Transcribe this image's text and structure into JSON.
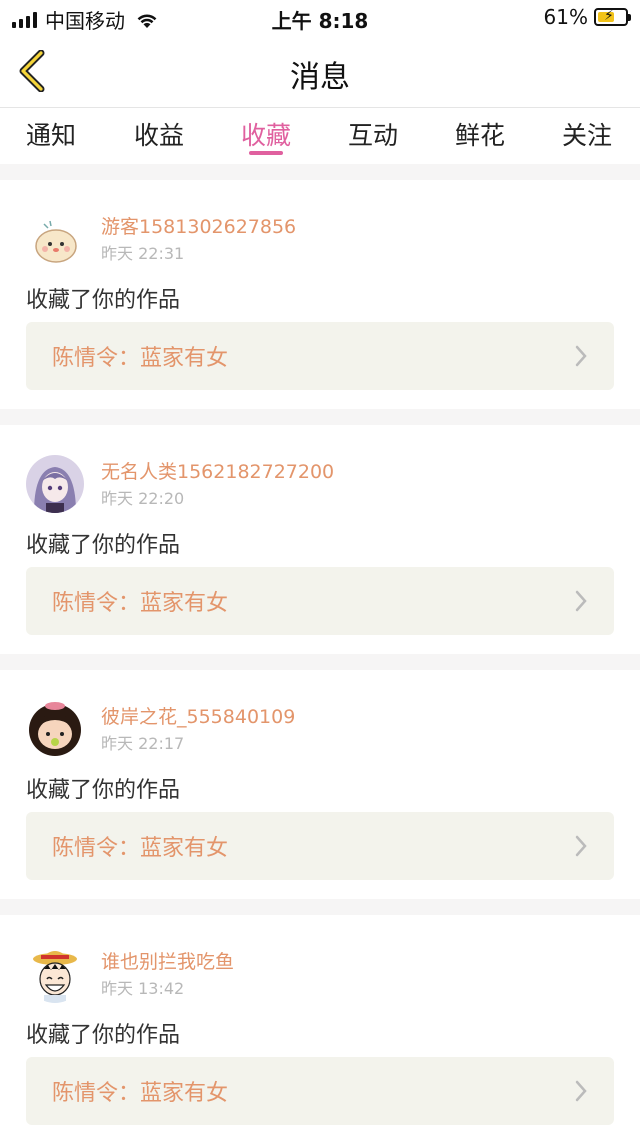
{
  "status_bar": {
    "carrier": "中国移动",
    "time": "上午 8:18",
    "battery_percent": "61%",
    "battery_level": 0.61,
    "battery_color": "#f2c31a"
  },
  "header": {
    "title": "消息",
    "back_icon": "chevron-left-icon"
  },
  "tabs": [
    {
      "label": "通知",
      "active": false
    },
    {
      "label": "收益",
      "active": false
    },
    {
      "label": "收藏",
      "active": true
    },
    {
      "label": "互动",
      "active": false
    },
    {
      "label": "鲜花",
      "active": false
    },
    {
      "label": "关注",
      "active": false
    }
  ],
  "colors": {
    "accent": "#e0609f",
    "name_orange": "#e3956b",
    "card_bg": "#f3f3ec"
  },
  "items": [
    {
      "username": "游客1581302627856",
      "time": "昨天 22:31",
      "action": "收藏了你的作品",
      "work": "陈情令：蓝家有女",
      "avatar": "chick-cartoon-avatar"
    },
    {
      "username": "无名人类1562182727200",
      "time": "昨天 22:20",
      "action": "收藏了你的作品",
      "work": "陈情令：蓝家有女",
      "avatar": "anime-girl-avatar"
    },
    {
      "username": "彼岸之花_555840109",
      "time": "昨天 22:17",
      "action": "收藏了你的作品",
      "work": "陈情令：蓝家有女",
      "avatar": "cartoon-girl-avatar"
    },
    {
      "username": "谁也别拦我吃鱼",
      "time": "昨天 13:42",
      "action": "收藏了你的作品",
      "work": "陈情令：蓝家有女",
      "avatar": "straw-hat-boy-avatar"
    }
  ]
}
